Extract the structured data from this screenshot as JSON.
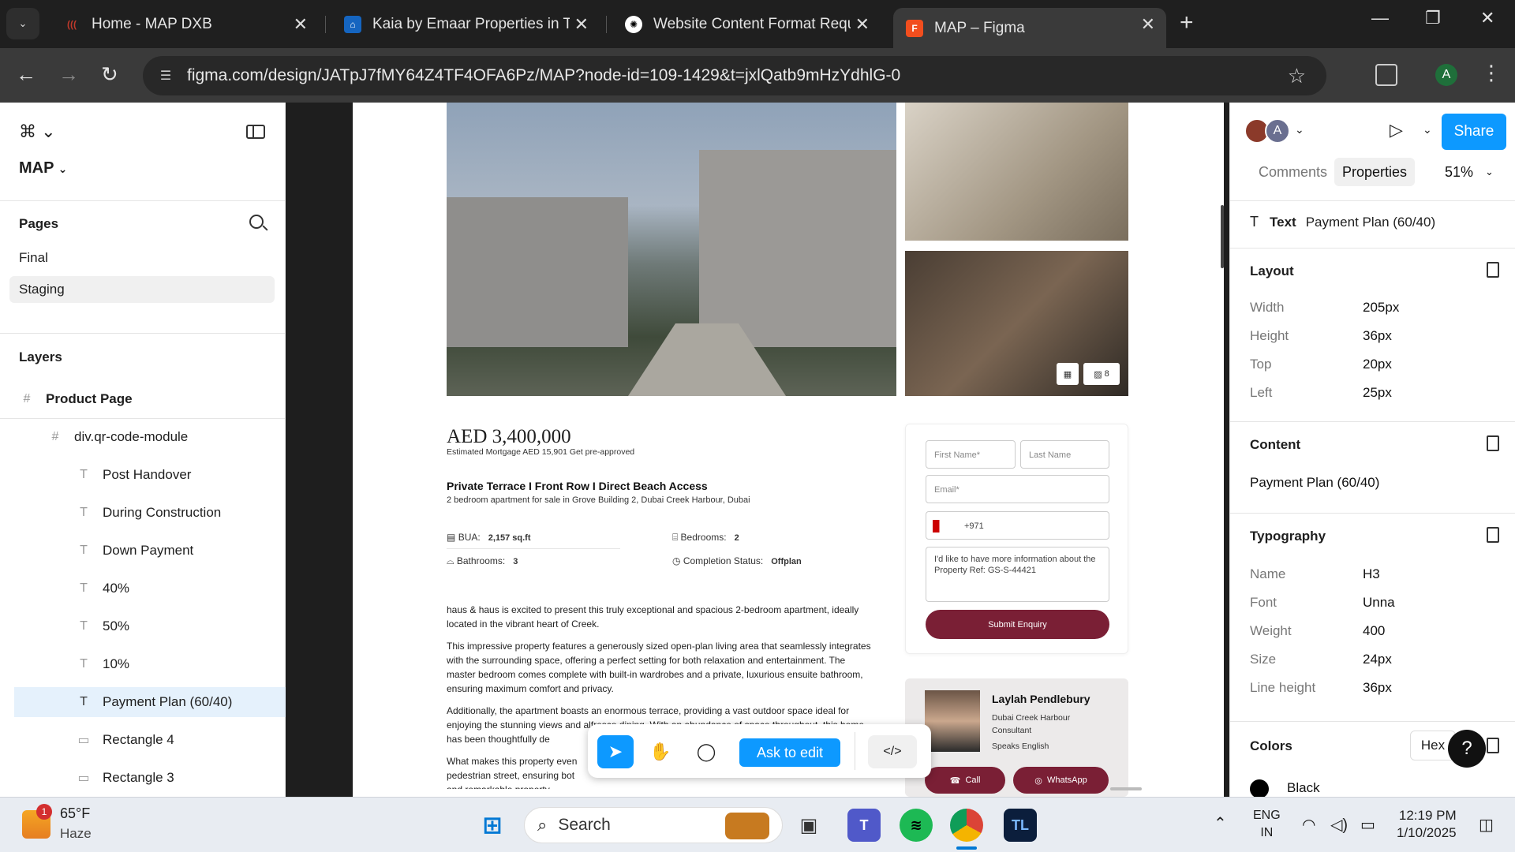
{
  "browser": {
    "tabs": [
      {
        "title": "Home - MAP DXB",
        "fav_color": "#c0392b",
        "fav_text": "((("
      },
      {
        "title": "Kaia by Emaar Properties in The",
        "fav_color": "#1565c0",
        "fav_text": "⌂"
      },
      {
        "title": "Website Content Format Reque",
        "fav_color": "#ffffff",
        "fav_text": "✺"
      },
      {
        "title": "MAP – Figma",
        "fav_color": "#f24e1e",
        "fav_text": "F"
      }
    ],
    "url": "figma.com/design/JATpJ7fMY64Z4TF4OFA6Pz/MAP?node-id=109-1429&t=jxlQatb9mHzYdhlG-0",
    "profile_initial": "A"
  },
  "left_panel": {
    "file_name": "MAP",
    "pages_heading": "Pages",
    "pages": [
      {
        "label": "Final",
        "selected": false
      },
      {
        "label": "Staging",
        "selected": true
      }
    ],
    "layers_heading": "Layers",
    "layers": [
      {
        "label": "Product Page",
        "type": "frame",
        "depth": 0,
        "bold": true
      },
      {
        "label": "div.qr-code-module",
        "type": "frame",
        "depth": 1
      },
      {
        "label": "Post Handover",
        "type": "text",
        "depth": 2
      },
      {
        "label": "During Construction",
        "type": "text",
        "depth": 2
      },
      {
        "label": "Down Payment",
        "type": "text",
        "depth": 2
      },
      {
        "label": "40%",
        "type": "text",
        "depth": 2
      },
      {
        "label": "50%",
        "type": "text",
        "depth": 2
      },
      {
        "label": "10%",
        "type": "text",
        "depth": 2
      },
      {
        "label": "Payment Plan (60/40)",
        "type": "text",
        "depth": 2,
        "selected": true
      },
      {
        "label": "Rectangle 4",
        "type": "rect",
        "depth": 2
      },
      {
        "label": "Rectangle 3",
        "type": "rect",
        "depth": 2
      }
    ]
  },
  "canvas": {
    "image_count": "8",
    "price": "AED 3,400,000",
    "mortgage": "Estimated Mortgage AED 15,901 Get pre-approved",
    "title": "Private Terrace I Front Row I Direct Beach Access",
    "subtitle": "2 bedroom apartment for sale  in Grove Building 2, Dubai Creek Harbour, Dubai",
    "specs": {
      "bua_label": "BUA:",
      "bua_value": "2,157 sq.ft",
      "bedrooms_label": "Bedrooms:",
      "bedrooms_value": "2",
      "bathrooms_label": "Bathrooms:",
      "bathrooms_value": "3",
      "completion_label": "Completion Status:",
      "completion_value": "Offplan"
    },
    "description": [
      "haus & haus is excited to present this truly exceptional and spacious 2-bedroom apartment, ideally located in the vibrant heart of Creek.",
      "This impressive property features a generously sized open-plan living area that seamlessly integrates with the surrounding space, offering a perfect setting for both relaxation and entertainment. The master bedroom comes complete with built-in wardrobes and a private, luxurious ensuite bathroom, ensuring maximum comfort and privacy.",
      "Additionally, the apartment boasts an enormous terrace, providing a vast outdoor space ideal for enjoying the stunning views and alfresco dining. With an abundance of space throughout, this home has been thoughtfully de",
      "What makes this property even pedestrian street, ensuring bot and remarkable property."
    ],
    "form": {
      "first_name": "First Name*",
      "last_name": "Last Name",
      "email": "Email*",
      "phone": "+971",
      "message": "I'd like to have more information about the Property Ref: GS-S-44421",
      "submit": "Submit Enquiry"
    },
    "agent": {
      "name": "Laylah Pendlebury",
      "company": "Dubai Creek Harbour",
      "role": "Consultant",
      "languages": "Speaks English",
      "call": "Call",
      "whatsapp": "WhatsApp"
    }
  },
  "toolbar": {
    "ask_to_edit": "Ask to edit",
    "code_icon": "</>"
  },
  "right_panel": {
    "share": "Share",
    "tab_comments": "Comments",
    "tab_properties": "Properties",
    "zoom": "51%",
    "selection_type": "Text",
    "selection_name": "Payment Plan (60/40)",
    "layout": {
      "heading": "Layout",
      "rows": [
        {
          "key": "Width",
          "value": "205px"
        },
        {
          "key": "Height",
          "value": "36px"
        },
        {
          "key": "Top",
          "value": "20px"
        },
        {
          "key": "Left",
          "value": "25px"
        }
      ]
    },
    "content": {
      "heading": "Content",
      "value": "Payment Plan (60/40)"
    },
    "typography": {
      "heading": "Typography",
      "rows": [
        {
          "key": "Name",
          "value": "H3"
        },
        {
          "key": "Font",
          "value": "Unna"
        },
        {
          "key": "Weight",
          "value": "400"
        },
        {
          "key": "Size",
          "value": "24px"
        },
        {
          "key": "Line height",
          "value": "36px"
        }
      ]
    },
    "colors": {
      "heading": "Colors",
      "format": "Hex",
      "first_color_name": "Black",
      "first_color": "#000000"
    }
  },
  "taskbar": {
    "weather_temp": "65°F",
    "weather_desc": "Haze",
    "weather_badge": "1",
    "search": "Search",
    "lang1": "ENG",
    "lang2": "IN",
    "time": "12:19 PM",
    "date": "1/10/2025"
  }
}
